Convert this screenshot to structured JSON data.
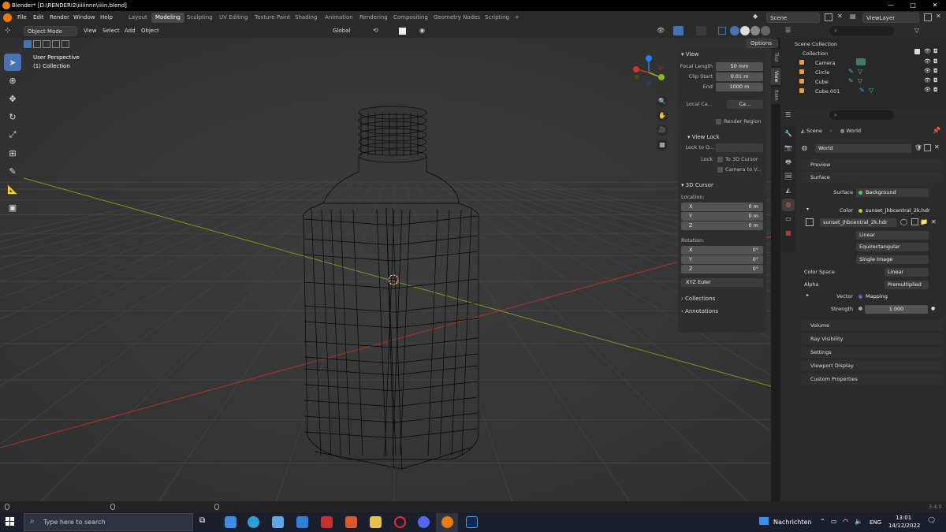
{
  "window": {
    "title": "Blender* [D:\\RENDERI2\\iiiiinnn\\iiiin.blend]",
    "minimize": "—",
    "maximize": "□",
    "close": "✕"
  },
  "menu": [
    "File",
    "Edit",
    "Render",
    "Window",
    "Help"
  ],
  "workspaces": [
    "Layout",
    "Modeling",
    "Sculpting",
    "UV Editing",
    "Texture Paint",
    "Shading",
    "Animation",
    "Rendering",
    "Compositing",
    "Geometry Nodes",
    "Scripting",
    "+"
  ],
  "active_workspace": "Modeling",
  "scene": {
    "label": "Scene",
    "viewlayer": "ViewLayer"
  },
  "viewport_header": {
    "mode": "Object Mode",
    "menus": [
      "View",
      "Select",
      "Add",
      "Object"
    ],
    "transform": "Global",
    "options": "Options"
  },
  "viewport": {
    "perspective": "User Perspective",
    "collection": "(1) Collection"
  },
  "npanel": {
    "view_title": "View",
    "focal_length_label": "Focal Length",
    "focal_length": "50 mm",
    "clip_start_label": "Clip Start",
    "clip_start": "0.01 m",
    "end_label": "End",
    "end": "1000 m",
    "local_camera_label": "Local Ca...",
    "local_camera": "Ca...",
    "render_region": "Render Region",
    "view_lock_title": "View Lock",
    "lock_to_label": "Lock to O...",
    "lock_label": "Lock",
    "to_3d_cursor": "To 3D Cursor",
    "camera_to_view": "Camera to V...",
    "cursor_title": "3D Cursor",
    "location_label": "Location:",
    "location": [
      {
        "k": "X",
        "v": "0 m"
      },
      {
        "k": "Y",
        "v": "0 m"
      },
      {
        "k": "Z",
        "v": "0 m"
      }
    ],
    "rotation_label": "Rotation:",
    "rotation": [
      {
        "k": "X",
        "v": "0°"
      },
      {
        "k": "Y",
        "v": "0°"
      },
      {
        "k": "Z",
        "v": "0°"
      }
    ],
    "rotation_mode": "XYZ Euler",
    "collections": "Collections",
    "annotations": "Annotations"
  },
  "vtabs": [
    "Tool",
    "View",
    "Item"
  ],
  "outliner": {
    "scene_collection": "Scene Collection",
    "collection": "Collection",
    "items": [
      "Camera",
      "Circle",
      "Cube",
      "Cube.001"
    ]
  },
  "properties": {
    "breadcrumb_scene": "Scene",
    "breadcrumb_world": "World",
    "world_name": "World",
    "preview": "Preview",
    "surface": "Surface",
    "surface_label": "Surface",
    "surface_value": "Background",
    "color_label": "Color",
    "color_value": "sunset_jhbcentral_2k.hdr",
    "image_name": "sunset_jhbcentral_2k.hdr",
    "interp": "Linear",
    "projection": "Equirectangular",
    "source": "Single Image",
    "color_space_label": "Color Space",
    "color_space": "Linear",
    "alpha_label": "Alpha",
    "alpha": "Premultiplied",
    "vector_label": "Vector",
    "vector": "Mapping",
    "strength_label": "Strength",
    "strength": "1.000",
    "panels": [
      "Volume",
      "Ray Visibility",
      "Settings",
      "Viewport Display",
      "Custom Properties"
    ]
  },
  "status": {
    "version": "3.4.0"
  },
  "taskbar": {
    "search_placeholder": "Type here to search",
    "weather": "Nachrichten",
    "lang": "ENG",
    "time": "13:01",
    "date": "14/12/2022"
  },
  "colors": {
    "accent": "#4772b3",
    "x_axis": "#cc3333",
    "y_axis": "#8ab822",
    "z_axis": "#2b7de9",
    "blender_orange": "#e87d0d"
  }
}
